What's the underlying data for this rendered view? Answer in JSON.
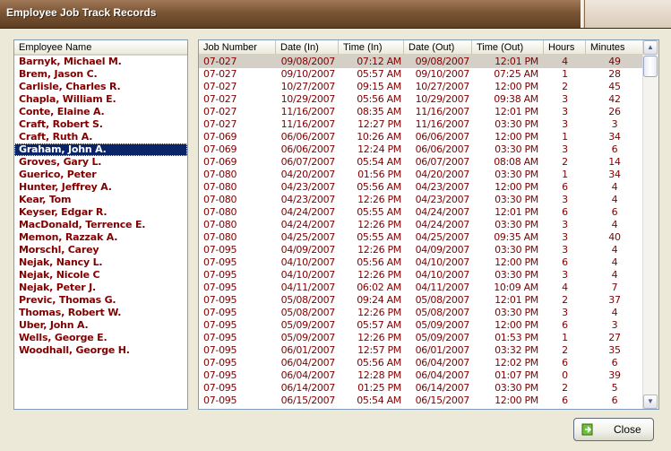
{
  "window": {
    "title": "Employee Job Track Records"
  },
  "employees": {
    "header": "Employee Name",
    "selected": "Graham, John A.",
    "items": [
      "Barnyk, Michael M.",
      "Brem, Jason C.",
      "Carlisle, Charles R.",
      "Chapla, William E.",
      "Conte, Elaine A.",
      "Craft, Robert S.",
      "Craft, Ruth A.",
      "Graham, John A.",
      "Groves, Gary L.",
      "Guerico, Peter",
      "Hunter, Jeffrey A.",
      "Kear, Tom",
      "Keyser, Edgar R.",
      "MacDonald, Terrence E.",
      "Memon, Razzak A.",
      "Morschl, Carey",
      "Nejak, Nancy L.",
      "Nejak, Nicole C",
      "Nejak, Peter J.",
      "Previc, Thomas G.",
      "Thomas, Robert W.",
      "Uber, John A.",
      "Wells, George E.",
      "Woodhall, George H."
    ]
  },
  "records": {
    "columns": [
      "Job Number",
      "Date (In)",
      "Time (In)",
      "Date (Out)",
      "Time (Out)",
      "Hours",
      "Minutes"
    ],
    "rows": [
      [
        "07-027",
        "09/08/2007",
        "07:12 AM",
        "09/08/2007",
        "12:01 PM",
        "4",
        "49"
      ],
      [
        "07-027",
        "09/10/2007",
        "05:57 AM",
        "09/10/2007",
        "07:25 AM",
        "1",
        "28"
      ],
      [
        "07-027",
        "10/27/2007",
        "09:15 AM",
        "10/27/2007",
        "12:00 PM",
        "2",
        "45"
      ],
      [
        "07-027",
        "10/29/2007",
        "05:56 AM",
        "10/29/2007",
        "09:38 AM",
        "3",
        "42"
      ],
      [
        "07-027",
        "11/16/2007",
        "08:35 AM",
        "11/16/2007",
        "12:01 PM",
        "3",
        "26"
      ],
      [
        "07-027",
        "11/16/2007",
        "12:27 PM",
        "11/16/2007",
        "03:30 PM",
        "3",
        "3"
      ],
      [
        "07-069",
        "06/06/2007",
        "10:26 AM",
        "06/06/2007",
        "12:00 PM",
        "1",
        "34"
      ],
      [
        "07-069",
        "06/06/2007",
        "12:24 PM",
        "06/06/2007",
        "03:30 PM",
        "3",
        "6"
      ],
      [
        "07-069",
        "06/07/2007",
        "05:54 AM",
        "06/07/2007",
        "08:08 AM",
        "2",
        "14"
      ],
      [
        "07-080",
        "04/20/2007",
        "01:56 PM",
        "04/20/2007",
        "03:30 PM",
        "1",
        "34"
      ],
      [
        "07-080",
        "04/23/2007",
        "05:56 AM",
        "04/23/2007",
        "12:00 PM",
        "6",
        "4"
      ],
      [
        "07-080",
        "04/23/2007",
        "12:26 PM",
        "04/23/2007",
        "03:30 PM",
        "3",
        "4"
      ],
      [
        "07-080",
        "04/24/2007",
        "05:55 AM",
        "04/24/2007",
        "12:01 PM",
        "6",
        "6"
      ],
      [
        "07-080",
        "04/24/2007",
        "12:26 PM",
        "04/24/2007",
        "03:30 PM",
        "3",
        "4"
      ],
      [
        "07-080",
        "04/25/2007",
        "05:55 AM",
        "04/25/2007",
        "09:35 AM",
        "3",
        "40"
      ],
      [
        "07-095",
        "04/09/2007",
        "12:26 PM",
        "04/09/2007",
        "03:30 PM",
        "3",
        "4"
      ],
      [
        "07-095",
        "04/10/2007",
        "05:56 AM",
        "04/10/2007",
        "12:00 PM",
        "6",
        "4"
      ],
      [
        "07-095",
        "04/10/2007",
        "12:26 PM",
        "04/10/2007",
        "03:30 PM",
        "3",
        "4"
      ],
      [
        "07-095",
        "04/11/2007",
        "06:02 AM",
        "04/11/2007",
        "10:09 AM",
        "4",
        "7"
      ],
      [
        "07-095",
        "05/08/2007",
        "09:24 AM",
        "05/08/2007",
        "12:01 PM",
        "2",
        "37"
      ],
      [
        "07-095",
        "05/08/2007",
        "12:26 PM",
        "05/08/2007",
        "03:30 PM",
        "3",
        "4"
      ],
      [
        "07-095",
        "05/09/2007",
        "05:57 AM",
        "05/09/2007",
        "12:00 PM",
        "6",
        "3"
      ],
      [
        "07-095",
        "05/09/2007",
        "12:26 PM",
        "05/09/2007",
        "01:53 PM",
        "1",
        "27"
      ],
      [
        "07-095",
        "06/01/2007",
        "12:57 PM",
        "06/01/2007",
        "03:32 PM",
        "2",
        "35"
      ],
      [
        "07-095",
        "06/04/2007",
        "05:56 AM",
        "06/04/2007",
        "12:02 PM",
        "6",
        "6"
      ],
      [
        "07-095",
        "06/04/2007",
        "12:28 PM",
        "06/04/2007",
        "01:07 PM",
        "0",
        "39"
      ],
      [
        "07-095",
        "06/14/2007",
        "01:25 PM",
        "06/14/2007",
        "03:30 PM",
        "2",
        "5"
      ],
      [
        "07-095",
        "06/15/2007",
        "05:54 AM",
        "06/15/2007",
        "12:00 PM",
        "6",
        "6"
      ]
    ]
  },
  "actions": {
    "close_label": "Close"
  },
  "colors": {
    "title_bar": "#7a5535",
    "list_text": "#800000",
    "selection": "#0a246a",
    "row_highlight": "#d4d0c8"
  }
}
